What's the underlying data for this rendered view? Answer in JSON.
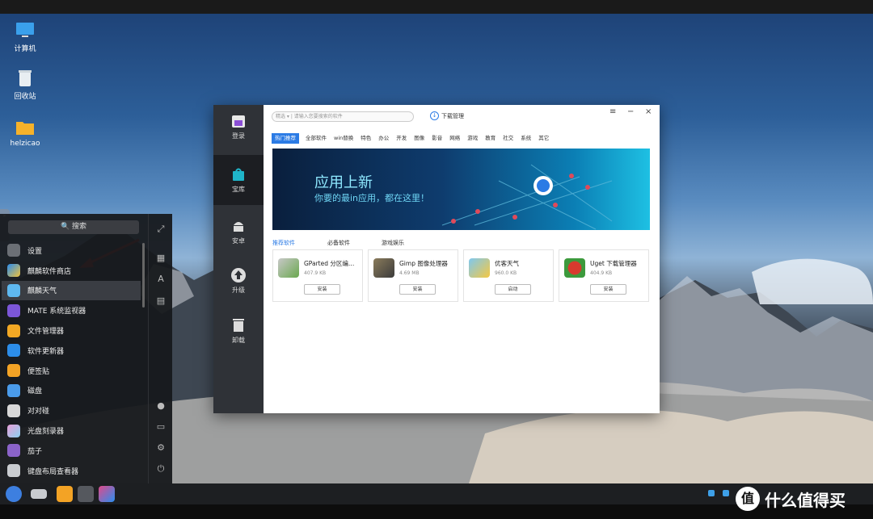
{
  "desktop": {
    "icons": [
      {
        "label": "计算机"
      },
      {
        "label": "回收站"
      },
      {
        "label": "helzicao"
      }
    ]
  },
  "start_menu": {
    "search": "搜索",
    "items": [
      {
        "label": "设置"
      },
      {
        "label": "麒麟软件商店"
      },
      {
        "label": "麒麟天气"
      },
      {
        "label": "MATE 系统监视器"
      },
      {
        "label": "文件管理器"
      },
      {
        "label": "软件更新器"
      },
      {
        "label": "便签贴"
      },
      {
        "label": "磁盘"
      },
      {
        "label": "对对碰"
      },
      {
        "label": "光盘刻录器"
      },
      {
        "label": "茄子"
      },
      {
        "label": "键盘布局查看器"
      }
    ]
  },
  "store": {
    "nav": [
      {
        "label": "登录"
      },
      {
        "label": "宝库"
      },
      {
        "label": "安卓"
      },
      {
        "label": "升级"
      },
      {
        "label": "卸载"
      }
    ],
    "search_select": "精选",
    "search_placeholder": "请输入您要搜索的软件",
    "download_label": "下载管理",
    "download_badge": "↓",
    "window_controls": [
      "≡",
      "−",
      "×"
    ],
    "tabs": [
      {
        "label": "热门推荐"
      },
      {
        "label": "全部软件"
      },
      {
        "label": "win替换"
      },
      {
        "label": "特色"
      },
      {
        "label": "办公"
      },
      {
        "label": "开发"
      },
      {
        "label": "图像"
      },
      {
        "label": "影音"
      },
      {
        "label": "网络"
      },
      {
        "label": "游戏"
      },
      {
        "label": "教育"
      },
      {
        "label": "社交"
      },
      {
        "label": "系统"
      },
      {
        "label": "其它"
      }
    ],
    "banner": {
      "title": "应用上新",
      "subtitle": "你要的最in应用，都在这里！"
    },
    "sections": [
      {
        "label": "推荐软件"
      },
      {
        "label": "必备软件"
      },
      {
        "label": "游戏娱乐"
      }
    ],
    "cards": [
      {
        "name": "GParted 分区编…",
        "size": "407.9 KB",
        "button": "安装"
      },
      {
        "name": "Gimp 图像处理器",
        "size": "4.69 MB",
        "button": "安装"
      },
      {
        "name": "优客天气",
        "size": "960.0 KB",
        "button": "启动"
      },
      {
        "name": "Uget 下载管理器",
        "size": "404.9 KB",
        "button": "安装"
      }
    ]
  },
  "watermark": {
    "text": "什么值得买",
    "icon": "值"
  },
  "colors": {
    "accent": "#2b7be5",
    "sidebar": "#2f3237",
    "annotation_arrow": "#e0302a"
  }
}
